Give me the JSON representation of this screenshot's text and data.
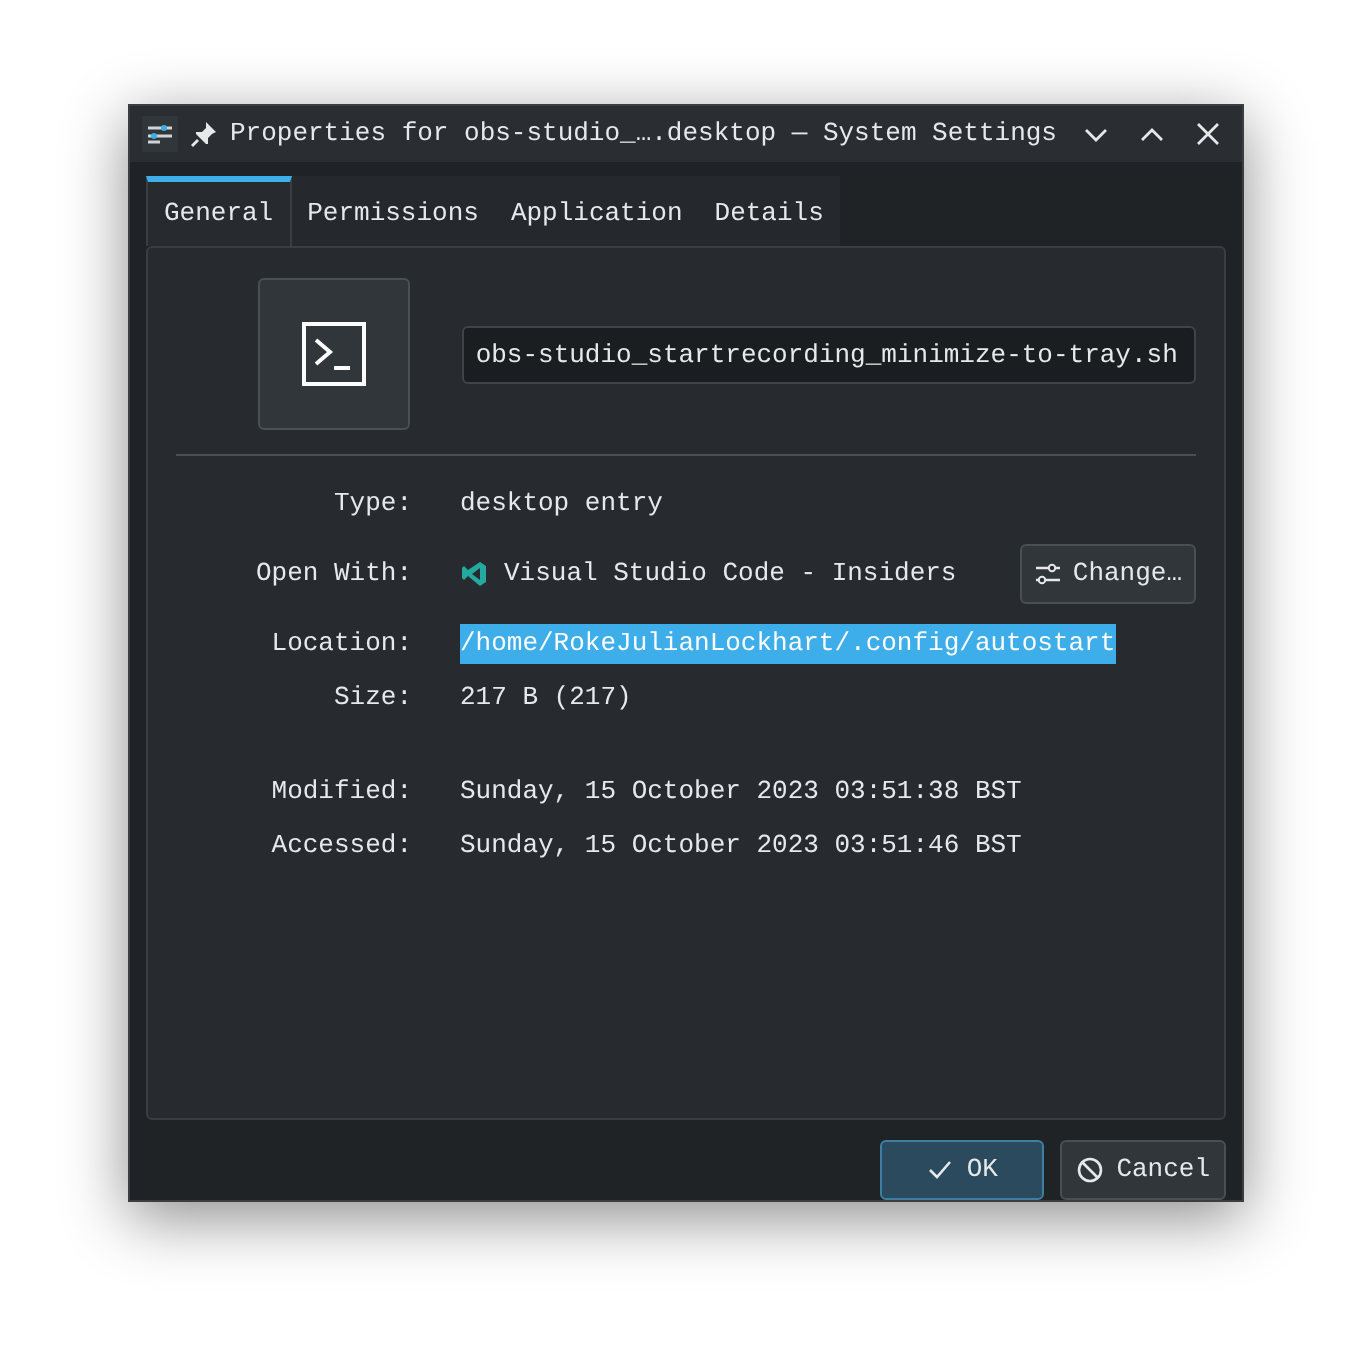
{
  "window": {
    "title": "Properties for obs-studio_….desktop — System Settings",
    "pinned": true
  },
  "tabs": [
    {
      "label": "General",
      "selected": true
    },
    {
      "label": "Permissions",
      "selected": false
    },
    {
      "label": "Application",
      "selected": false
    },
    {
      "label": "Details",
      "selected": false
    }
  ],
  "file": {
    "name": "obs-studio_startrecording_minimize-to-tray.sh"
  },
  "properties": [
    {
      "kind": "text",
      "label": "Type:",
      "value": "desktop entry"
    },
    {
      "kind": "app",
      "label": "Open With:",
      "value": "Visual Studio Code - Insiders",
      "button": "Change…"
    },
    {
      "kind": "text",
      "label": "Location:",
      "value": "/home/RokeJulianLockhart/.config/autostart",
      "highlighted": true
    },
    {
      "kind": "text",
      "label": "Size:",
      "value": "217 B (217)"
    },
    {
      "kind": "gap"
    },
    {
      "kind": "text",
      "label": "Modified:",
      "value": "Sunday, 15 October 2023 03:51:38 BST"
    },
    {
      "kind": "text",
      "label": "Accessed:",
      "value": "Sunday, 15 October 2023 03:51:46 BST"
    }
  ],
  "buttons": [
    {
      "kind": "ok",
      "label": "OK",
      "default": true
    },
    {
      "kind": "cancel",
      "label": "Cancel",
      "default": false
    }
  ]
}
